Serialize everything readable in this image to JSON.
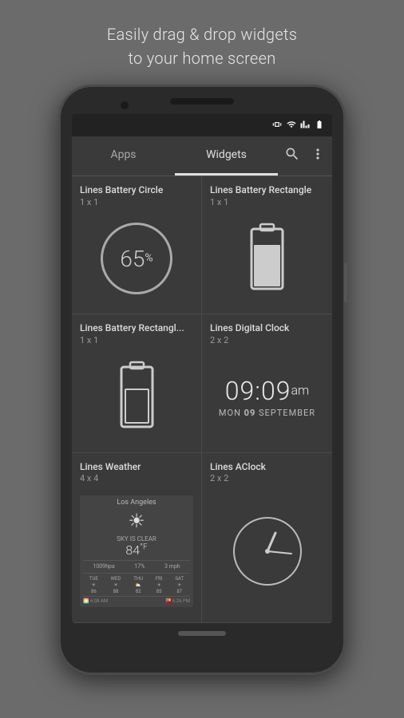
{
  "page": {
    "top_text_line1": "Easily drag & drop widgets",
    "top_text_line2": "to your home screen"
  },
  "tabs": {
    "apps_label": "Apps",
    "widgets_label": "Widgets"
  },
  "widgets": [
    {
      "title": "Lines Battery Circle",
      "size": "1 x 1",
      "type": "battery_circle",
      "value": "65"
    },
    {
      "title": "Lines Battery Rectangle",
      "size": "1 x 1",
      "type": "battery_rect_full"
    },
    {
      "title": "Lines Battery Rectangl...",
      "size": "1 x 1",
      "type": "battery_rect_empty"
    },
    {
      "title": "Lines Digital Clock",
      "size": "2 x 2",
      "type": "digital_clock",
      "time": "09:09",
      "ampm": "am",
      "date": "MON 09 SEPTEMBER"
    },
    {
      "title": "Lines Weather",
      "size": "4 x 4",
      "type": "weather",
      "city": "Los Angeles",
      "condition": "SKY IS CLEAR",
      "temp": "84",
      "wind": "3 mph",
      "humidity": "17%",
      "pressure": "1009hpa"
    },
    {
      "title": "Lines AClock",
      "size": "2 x 2",
      "type": "analog_clock"
    }
  ],
  "status_bar": {
    "vibrate": "📳",
    "wifi": "WiFi",
    "signal": "Signal",
    "battery": "Battery"
  }
}
